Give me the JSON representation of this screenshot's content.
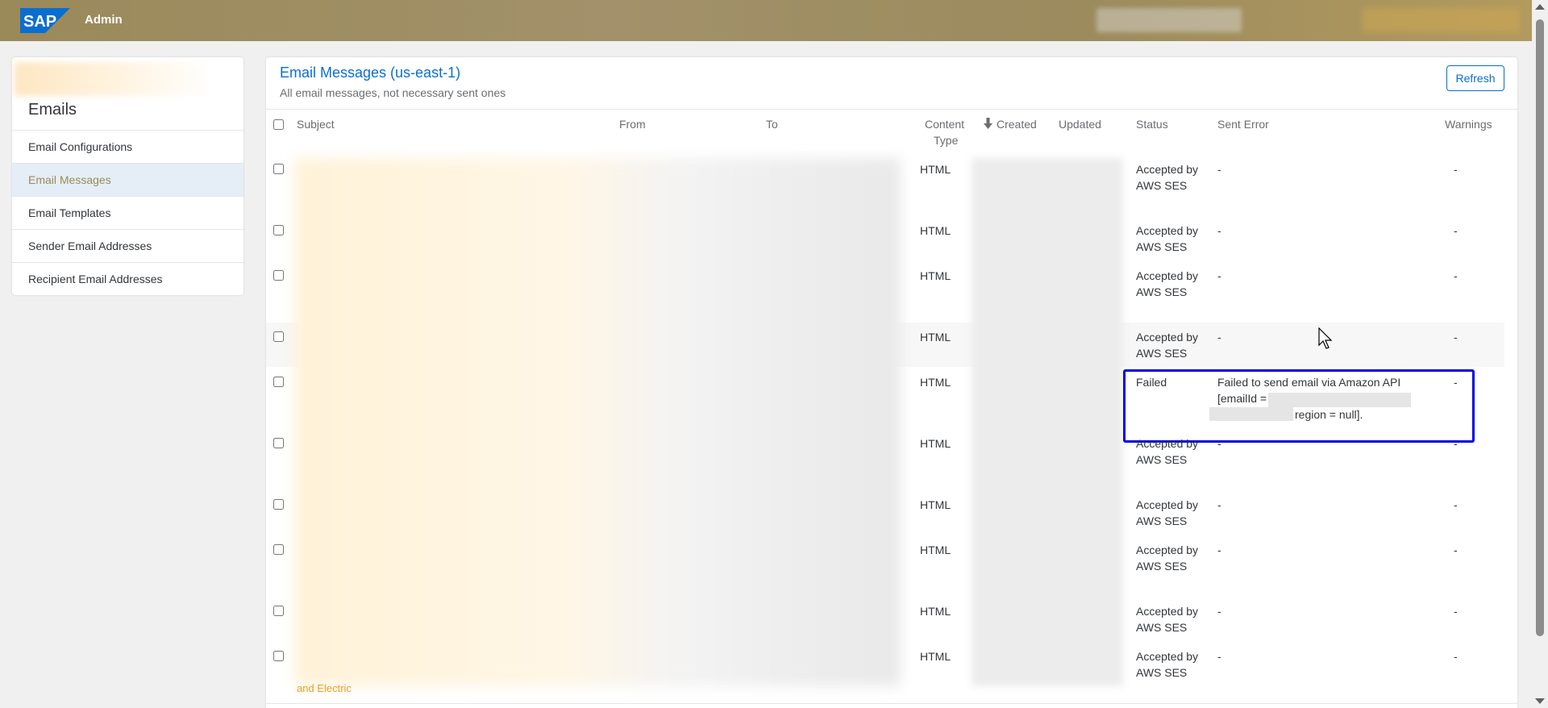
{
  "header": {
    "logo_text": "SAP",
    "title": "Admin"
  },
  "sidebar": {
    "title": "Emails",
    "items": [
      {
        "label": "Email Configurations"
      },
      {
        "label": "Email Messages"
      },
      {
        "label": "Email Templates"
      },
      {
        "label": "Sender Email Addresses"
      },
      {
        "label": "Recipient Email Addresses"
      }
    ]
  },
  "main": {
    "title": "Email Messages (us-east-1)",
    "subtitle": "All email messages, not necessary sent ones",
    "refresh_label": "Refresh",
    "columns": {
      "subject": "Subject",
      "from": "From",
      "to": "To",
      "content_type_1": "Content",
      "content_type_2": "Type",
      "created": "Created",
      "updated": "Updated",
      "status": "Status",
      "sent_error": "Sent Error",
      "warnings": "Warnings"
    },
    "rows": [
      {
        "content_type": "HTML",
        "status_1": "Accepted by",
        "status_2": "AWS SES",
        "sent_error": "-",
        "warnings": "-"
      },
      {
        "content_type": "HTML",
        "status_1": "Accepted by",
        "status_2": "AWS SES",
        "sent_error": "-",
        "warnings": "-"
      },
      {
        "content_type": "HTML",
        "status_1": "Accepted by",
        "status_2": "AWS SES",
        "sent_error": "-",
        "warnings": "-"
      },
      {
        "content_type": "HTML",
        "status_1": "Accepted by",
        "status_2": "AWS SES",
        "sent_error": "-",
        "warnings": "-"
      },
      {
        "content_type": "HTML",
        "status_1": "Failed",
        "status_2": "",
        "sent_error_1": "Failed to send email via Amazon API",
        "sent_error_2": "[emailId =",
        "sent_error_3": "region = null].",
        "warnings": "-"
      },
      {
        "content_type": "HTML",
        "status_1": "Accepted by",
        "status_2": "AWS SES",
        "sent_error": "-",
        "warnings": "-"
      },
      {
        "content_type": "HTML",
        "status_1": "Accepted by",
        "status_2": "AWS SES",
        "sent_error": "-",
        "warnings": "-"
      },
      {
        "content_type": "HTML",
        "status_1": "Accepted by",
        "status_2": "AWS SES",
        "sent_error": "-",
        "warnings": "-"
      },
      {
        "content_type": "HTML",
        "status_1": "Accepted by",
        "status_2": "AWS SES",
        "sent_error": "-",
        "warnings": "-"
      },
      {
        "content_type": "HTML",
        "status_1": "Accepted by",
        "status_2": "AWS SES",
        "sent_error": "-",
        "warnings": "-"
      }
    ],
    "subject_tail": "and Electric"
  },
  "colors": {
    "shellbar": "#9a8a5a",
    "accent": "#0a6ed1",
    "focus_outline": "#0000e6",
    "selected_nav_bg": "#e5eef7"
  },
  "icons": {
    "sort": "arrow-down-icon",
    "cursor": "mouse-cursor-icon"
  }
}
